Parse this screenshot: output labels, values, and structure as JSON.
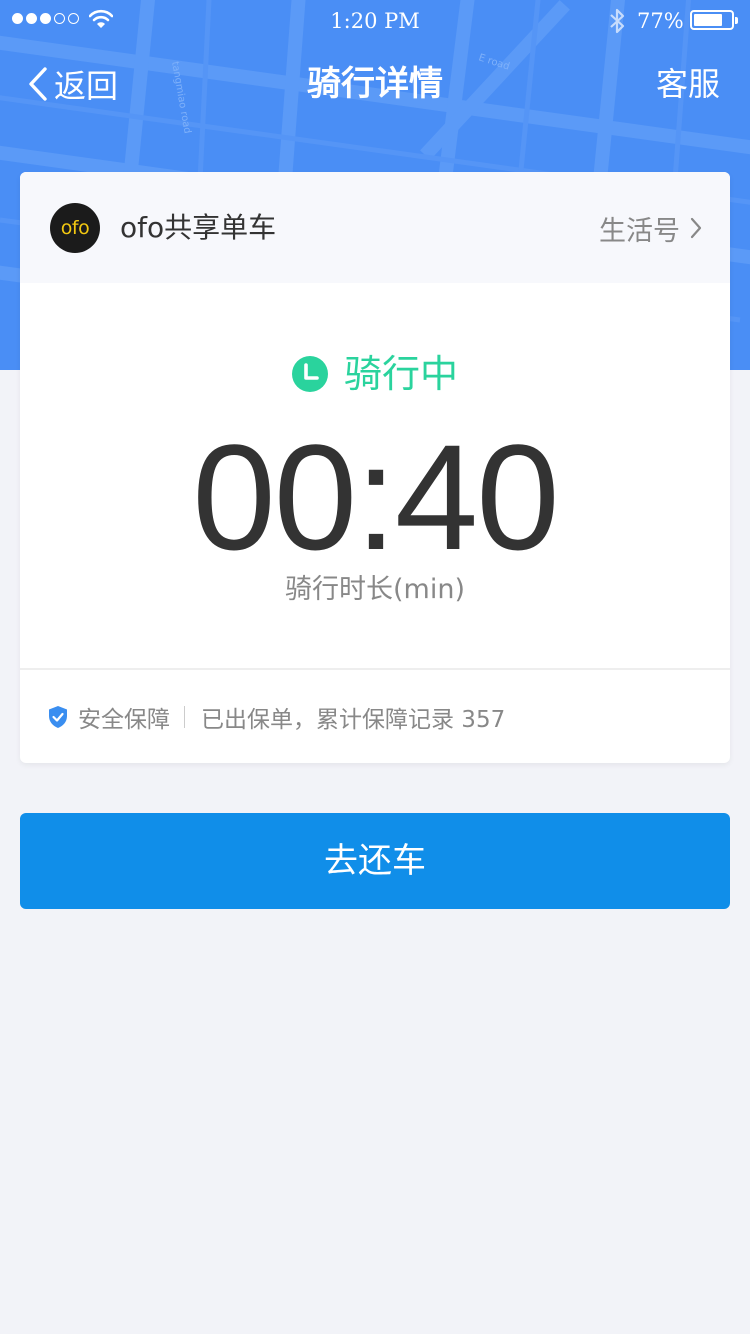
{
  "status_bar": {
    "signal_dots_filled": 3,
    "signal_dots_total": 5,
    "time": "1:20 PM",
    "battery_percent_text": "77%",
    "battery_level": 0.77
  },
  "nav": {
    "back_label": "返回",
    "title": "骑行详情",
    "service_label": "客服"
  },
  "card": {
    "brand_logo_text": "ofo",
    "brand_name": "ofo共享单车",
    "life_account_label": "生活号",
    "status": "骑行中",
    "timer_value": "00:40",
    "timer_label": "骑行时长(min)",
    "insurance_label": "安全保障",
    "insurance_info": "已出保单，累计保障记录 357"
  },
  "return_button_label": "去还车",
  "map_labels": {
    "road_1": "tangmiao road",
    "road_2": "E road"
  },
  "colors": {
    "header_blue": "#4a8ef5",
    "status_green": "#2ad39d",
    "primary_button": "#108ee9",
    "shield_blue": "#3a8ef0",
    "page_bg": "#f2f3f8"
  },
  "icons": {
    "back": "chevron-left-icon",
    "life_account_arrow": "chevron-right-icon",
    "status": "clock-icon",
    "insurance": "shield-check-icon",
    "wifi": "wifi-icon",
    "bluetooth": "bluetooth-icon",
    "battery": "battery-icon"
  }
}
